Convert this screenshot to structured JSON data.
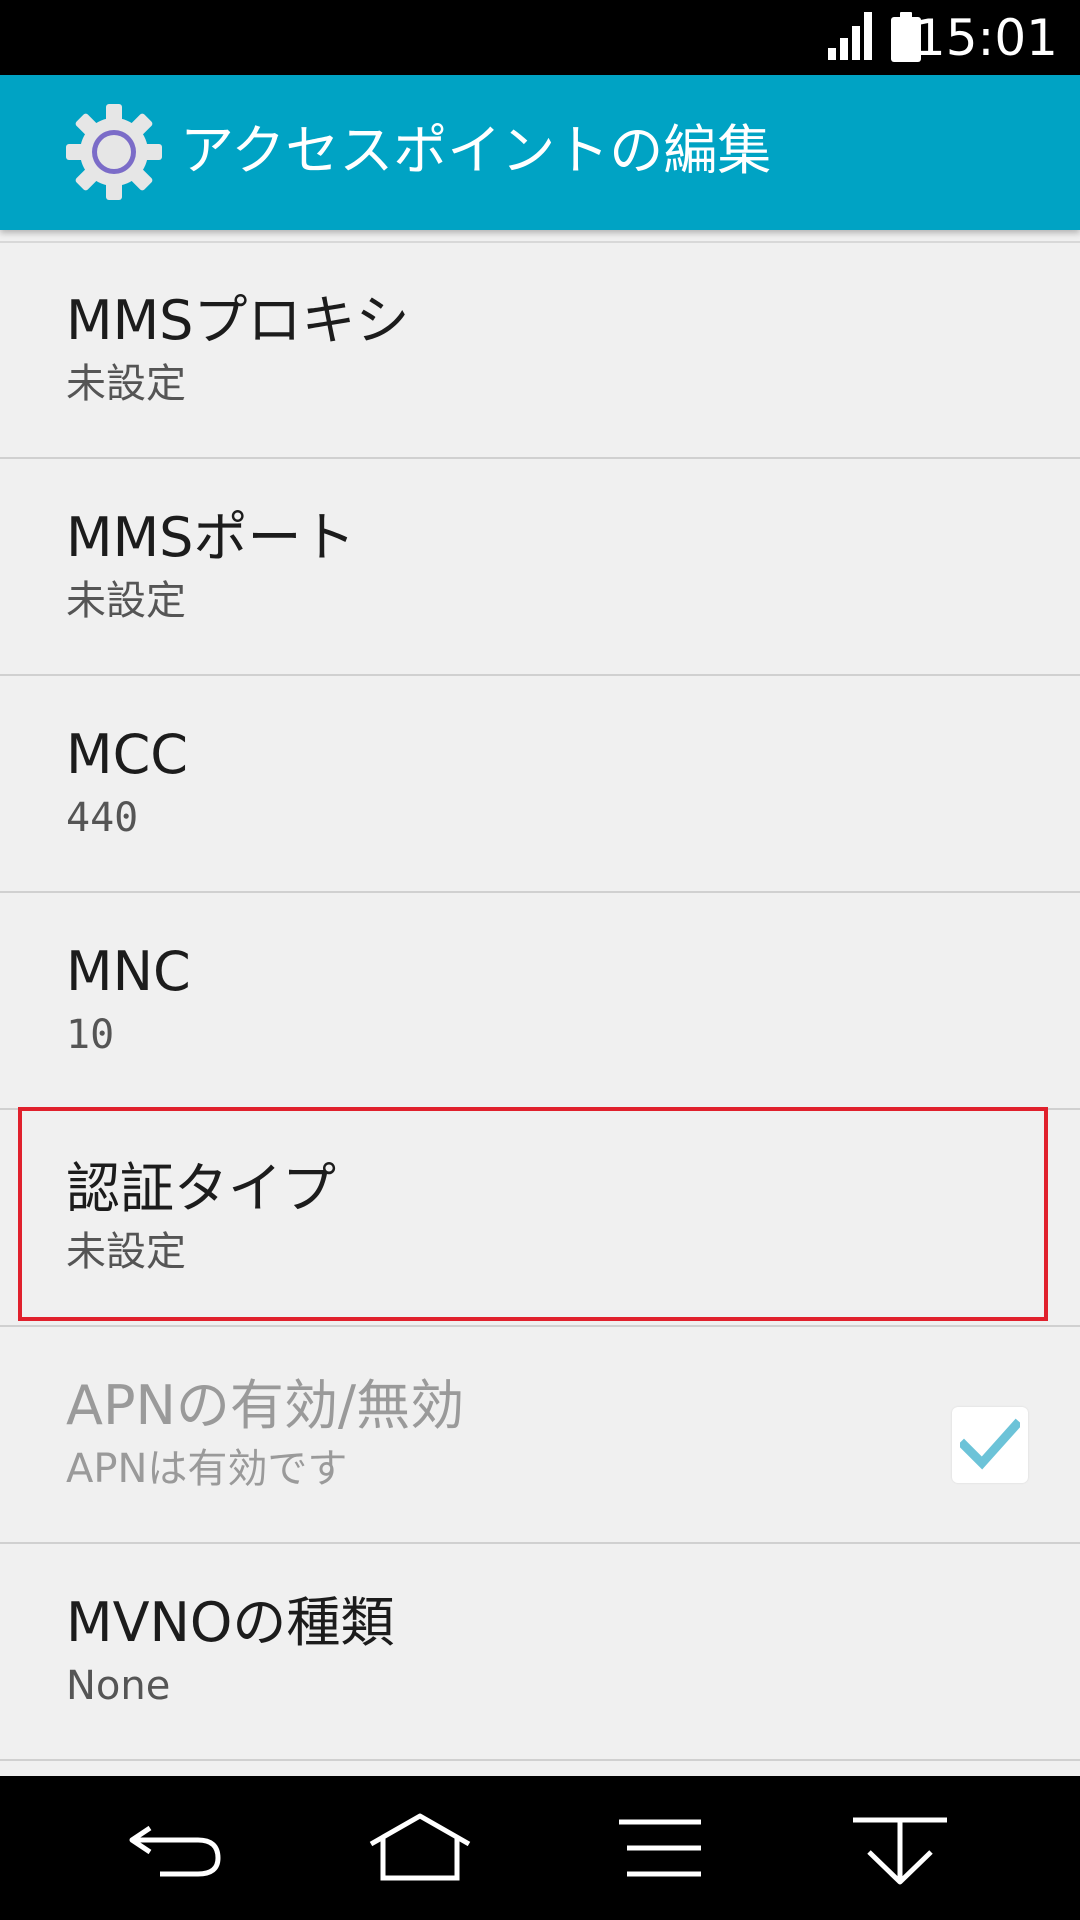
{
  "status_bar": {
    "time": "15:01",
    "icons": [
      "signal-icon",
      "battery-icon"
    ]
  },
  "app_bar": {
    "icon": "settings-gear-icon",
    "title": "アクセスポイントの編集",
    "color": "#00a3c4"
  },
  "settings": {
    "items": [
      {
        "label": "MMSプロキシ",
        "value": "未設定"
      },
      {
        "label": "MMSポート",
        "value": "未設定"
      },
      {
        "label": "MCC",
        "value": "440"
      },
      {
        "label": "MNC",
        "value": "10"
      },
      {
        "label": "認証タイプ",
        "value": "未設定",
        "highlighted": true
      },
      {
        "label": "APNの有効/無効",
        "value": "APNは有効です",
        "disabled": true,
        "checked": true
      },
      {
        "label": "MVNOの種類",
        "value": "None"
      }
    ]
  },
  "highlight_color": "#e0202c",
  "nav_bar": {
    "buttons": [
      "back-icon",
      "home-icon",
      "menu-icon",
      "hide-keyboard-icon"
    ]
  }
}
